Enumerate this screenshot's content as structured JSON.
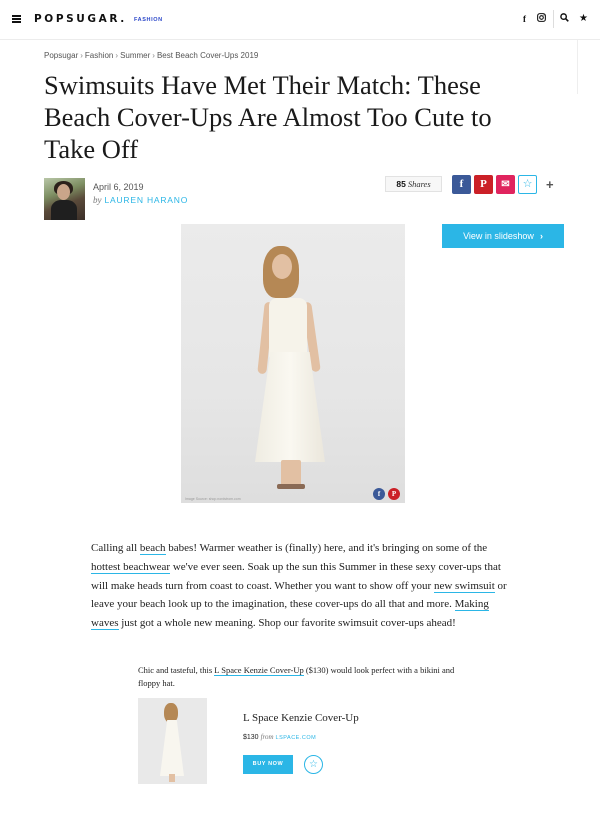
{
  "header": {
    "logo": "POPSUGAR.",
    "logo_section": "FASHION",
    "icons": [
      "menu-icon",
      "facebook-icon",
      "instagram-icon",
      "search-icon",
      "star-icon"
    ]
  },
  "breadcrumb": {
    "items": [
      "Popsugar",
      "Fashion",
      "Summer",
      "Best Beach Cover-Ups 2019"
    ],
    "separator": "›"
  },
  "article": {
    "title": "Swimsuits Have Met Their Match: These Beach Cover-Ups Are Almost Too Cute to Take Off",
    "date": "April 6, 2019",
    "by": "by",
    "author": "LAUREN HARANO",
    "shares_count": "85",
    "shares_label": "Shares",
    "slideshow_label": "View in slideshow",
    "image_credit": "Image Source: shop.nordstrom.com",
    "body": {
      "p1": "Calling all ",
      "link1": "beach",
      "p2": " babes! Warmer weather is (finally) here, and it's bringing on some of the ",
      "link2": "hottest beachwear",
      "p3": " we've ever seen. Soak up the sun this Summer in these sexy cover-ups that will make heads turn from coast to coast. Whether you want to show off your ",
      "link3": "new swimsuit",
      "p4": " or leave your beach look up to the imagination, these cover-ups do all that and more. ",
      "link4": "Making waves",
      "p5": " just got a whole new meaning. Shop our favorite swimsuit cover-ups ahead!"
    }
  },
  "product": {
    "caption_pre": "Chic and tasteful, this ",
    "caption_link": "L Space Kenzie Cover-Up",
    "caption_post": " ($130) would look perfect with a bikini and floppy hat.",
    "name": "L Space Kenzie Cover-Up",
    "price": "$130",
    "from": "from",
    "store": "LSPACE.COM",
    "buy_label": "BUY NOW"
  },
  "colors": {
    "accent": "#2bb6e6",
    "facebook": "#3b5998",
    "pinterest": "#cb2027",
    "email": "#e0245e"
  }
}
